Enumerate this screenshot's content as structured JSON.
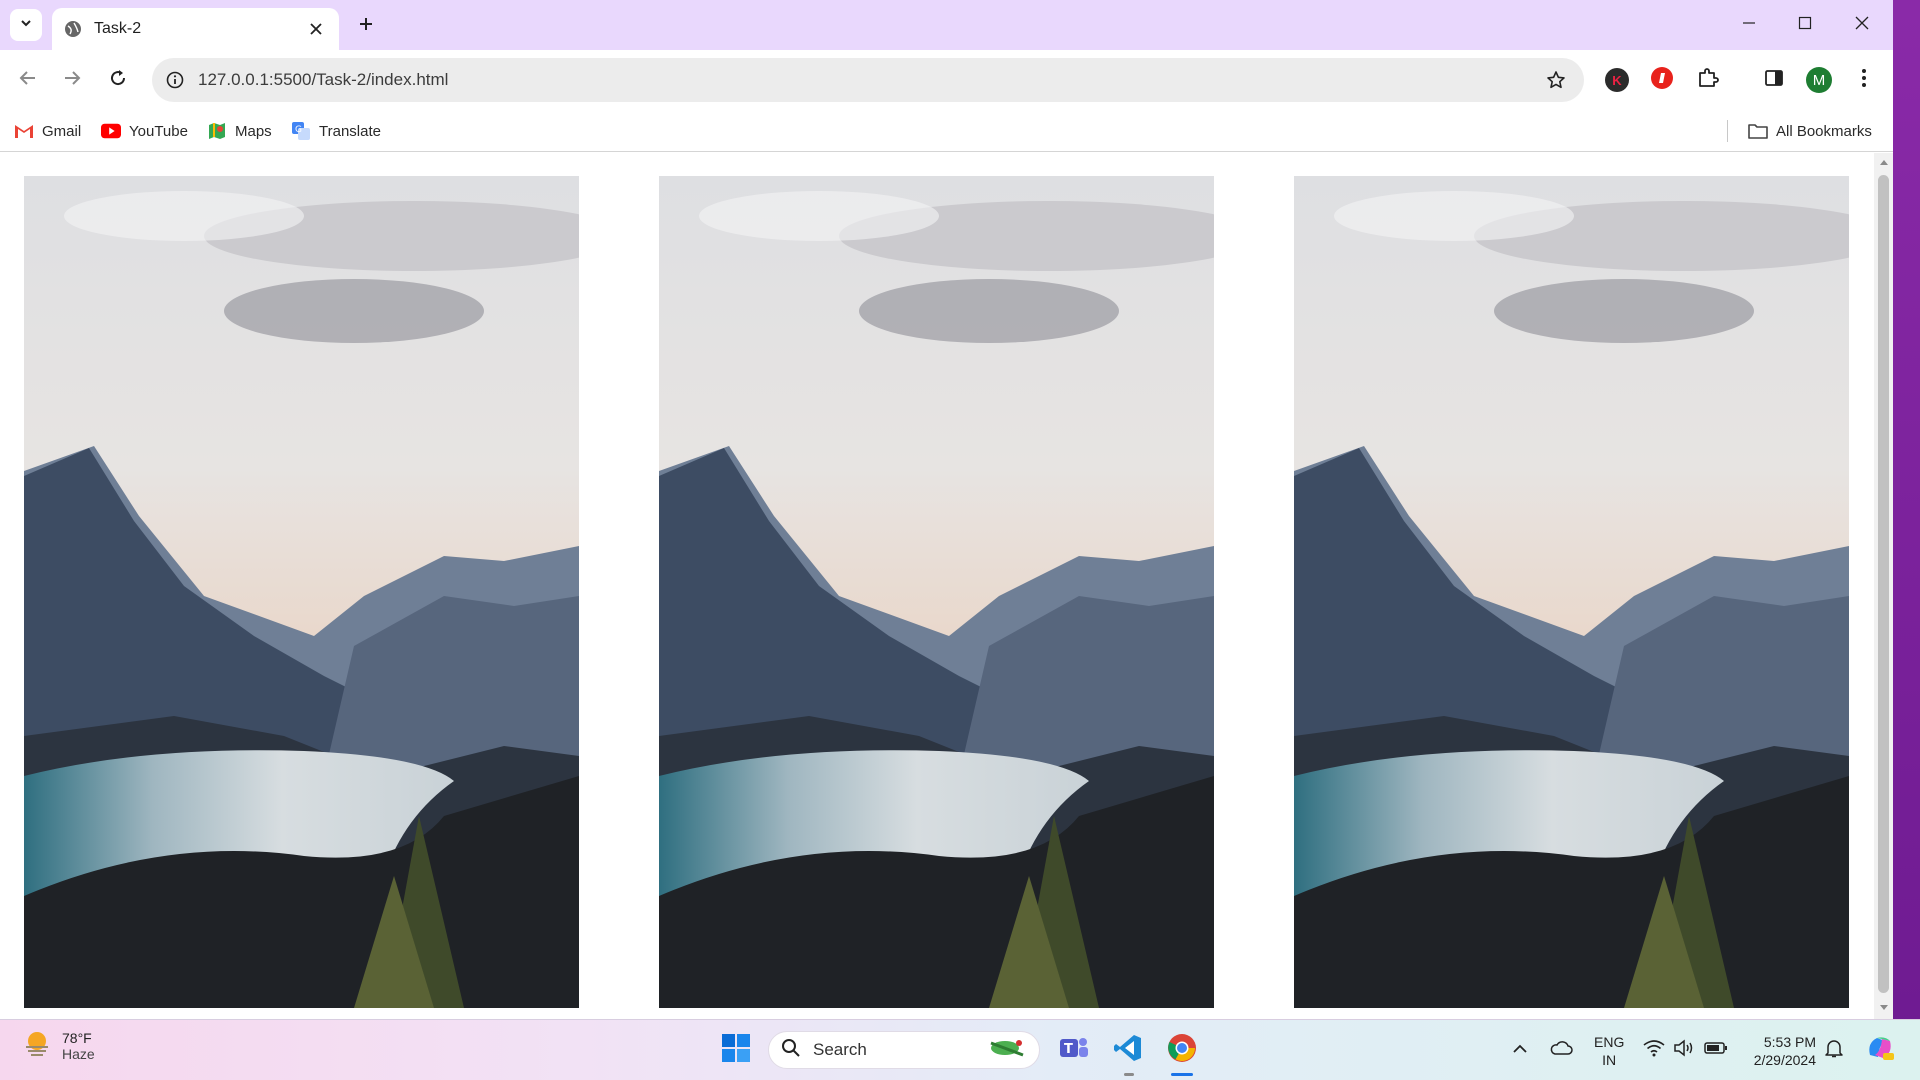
{
  "browser": {
    "tab": {
      "title": "Task-2"
    },
    "address_bar": {
      "url": "127.0.0.1:5500/Task-2/index.html"
    },
    "profile_initial": "M",
    "extension_initial": "K"
  },
  "bookmarks": {
    "items": [
      {
        "label": "Gmail",
        "icon": "gmail-icon"
      },
      {
        "label": "YouTube",
        "icon": "youtube-icon"
      },
      {
        "label": "Maps",
        "icon": "maps-icon"
      },
      {
        "label": "Translate",
        "icon": "translate-icon"
      }
    ],
    "all_bookmarks": "All Bookmarks"
  },
  "page": {
    "images": [
      {
        "name": "mountain-lake-photo-1"
      },
      {
        "name": "mountain-lake-photo-2"
      },
      {
        "name": "mountain-lake-photo-3"
      }
    ]
  },
  "taskbar": {
    "weather": {
      "temp": "78°F",
      "condition": "Haze"
    },
    "search_label": "Search",
    "language": {
      "line1": "ENG",
      "line2": "IN"
    },
    "clock": {
      "time": "5:53 PM",
      "date": "2/29/2024"
    }
  },
  "colors": {
    "tabstrip": "#e9d8fd",
    "taskbar_accent": "#1a73e8",
    "window_edge": "#7a1a9a"
  }
}
